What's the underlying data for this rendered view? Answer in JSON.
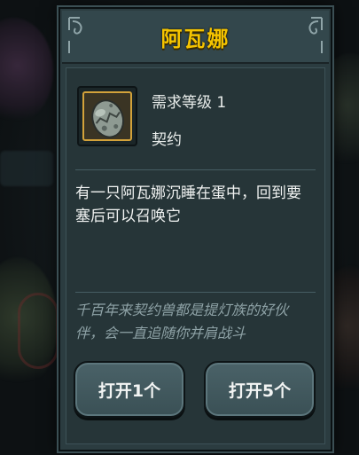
{
  "panel": {
    "title": "阿瓦娜"
  },
  "item": {
    "icon": "egg-icon",
    "requirement": "需求等级 1",
    "type": "契约",
    "description": "有一只阿瓦娜沉睡在蛋中，回到要塞后可以召唤它",
    "flavor": "千百年来契约兽都是提灯族的好伙伴，会一直追随你并肩战斗"
  },
  "buttons": {
    "open_one": "打开1个",
    "open_five": "打开5个"
  },
  "colors": {
    "title": "#f5c400",
    "panel": "#2b3c40",
    "button": "#4a6268",
    "slot_border": "#d3a23a",
    "flavor_text": "#8ea2a6"
  }
}
